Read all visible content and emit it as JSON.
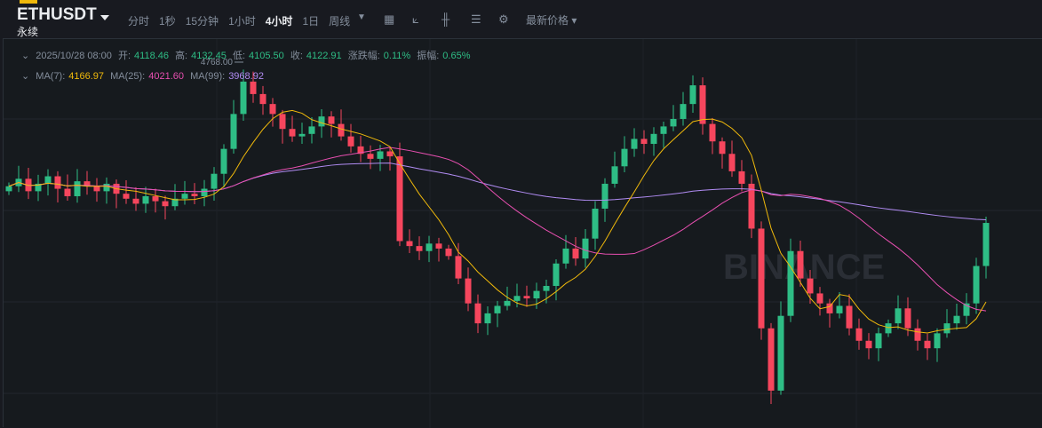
{
  "header": {
    "symbol": "ETHUSDT",
    "contract": "永续",
    "intervals": [
      "分时",
      "1秒",
      "15分钟",
      "1小时",
      "4小时",
      "1日",
      "周线"
    ],
    "active_interval": "4小时",
    "price_type": "最新价格"
  },
  "ohlc": {
    "time": "2025/10/28 08:00",
    "open_label": "开:",
    "open": "4118.46",
    "high_label": "高:",
    "high": "4132.45",
    "low_label": "低:",
    "low": "4105.50",
    "close_label": "收:",
    "close": "4122.91",
    "change_label": "涨跌幅:",
    "change": "0.11%",
    "amp_label": "振幅:",
    "amp": "0.65%"
  },
  "ma": {
    "ma7_label": "MA(7):",
    "ma7": "4166.97",
    "ma25_label": "MA(25):",
    "ma25": "4021.60",
    "ma99_label": "MA(99):",
    "ma99": "3968.92"
  },
  "colors": {
    "up": "#2ebd85",
    "down": "#f6465d",
    "ma7": "#f0b90b",
    "ma25": "#e74fb0",
    "ma99": "#b18cf3"
  },
  "chart_data": {
    "type": "candlestick",
    "ylim": [
      3300,
      4800
    ],
    "high_marker": "4768.00",
    "watermark": "BINANCE",
    "closes": [
      4270,
      4300,
      4250,
      4280,
      4310,
      4260,
      4230,
      4290,
      4270,
      4250,
      4280,
      4240,
      4220,
      4200,
      4230,
      4210,
      4190,
      4220,
      4240,
      4230,
      4260,
      4320,
      4420,
      4560,
      4690,
      4640,
      4600,
      4560,
      4500,
      4470,
      4480,
      4510,
      4550,
      4520,
      4470,
      4430,
      4400,
      4380,
      4410,
      4390,
      4050,
      4030,
      4010,
      4040,
      4020,
      3990,
      3900,
      3800,
      3720,
      3760,
      3790,
      3810,
      3830,
      3820,
      3850,
      3870,
      3960,
      4020,
      3980,
      4060,
      4180,
      4280,
      4350,
      4420,
      4460,
      4440,
      4480,
      4510,
      4540,
      4600,
      4675,
      4520,
      4450,
      4400,
      4330,
      4280,
      4100,
      3700,
      3450,
      3750,
      4010,
      3900,
      3840,
      3800,
      3760,
      3790,
      3700,
      3650,
      3620,
      3680,
      3720,
      3780,
      3700,
      3650,
      3620,
      3680,
      3720,
      3750,
      3800,
      3950,
      4122.91
    ]
  }
}
